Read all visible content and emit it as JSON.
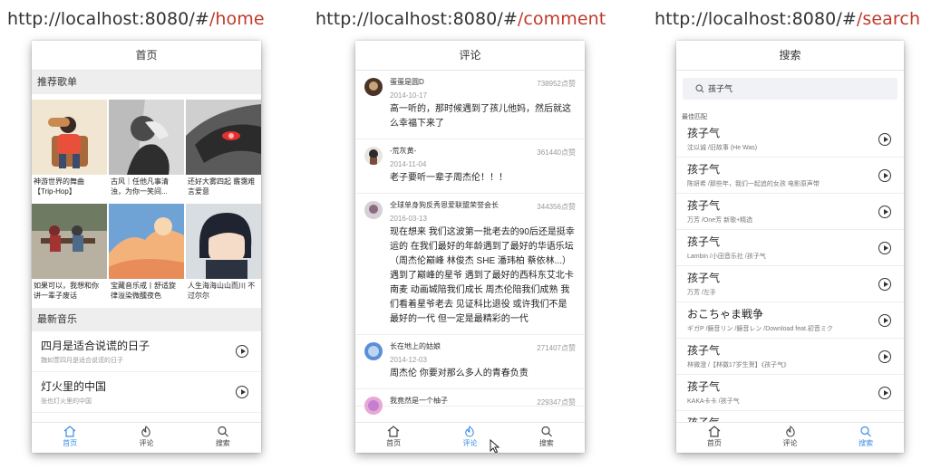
{
  "urls": [
    {
      "base": "http://localhost:8080/#",
      "route": "/home"
    },
    {
      "base": "http://localhost:8080/#",
      "route": "/comment"
    },
    {
      "base": "http://localhost:8080/#",
      "route": "/search"
    }
  ],
  "colors": {
    "accent": "#3a8ee6",
    "route": "#c0392b",
    "section_bg": "#eeeeee"
  },
  "tabs": [
    {
      "label": "首页",
      "icon": "home-icon"
    },
    {
      "label": "评论",
      "icon": "fire-icon"
    },
    {
      "label": "搜索",
      "icon": "search-icon"
    }
  ],
  "home": {
    "title": "首页",
    "recommend_title": "推荐歌单",
    "playlists": [
      {
        "caption": "神游世界的舞曲【Trip-Hop】"
      },
      {
        "caption": "古风｜任他凡事清浊，为你一笑间..."
      },
      {
        "caption": "还好大雾四起 霰霭难言爱意"
      },
      {
        "caption": "如果可以，我想和你讲一辈子废话"
      },
      {
        "caption": "宝藏音乐戒丨舒适旋律溢染微醺夜色"
      },
      {
        "caption": "人生海海山山而川 不过尔尔"
      }
    ],
    "latest_title": "最新音乐",
    "songs": [
      {
        "title": "四月是适合说谎的日子",
        "sub": "魏如萱四月是适合说谎的日子"
      },
      {
        "title": "灯火里的中国",
        "sub": "张也灯火里的中国"
      }
    ]
  },
  "comment": {
    "title": "评论",
    "items": [
      {
        "nick": "蛋蛋是圆D",
        "likes": "738952点赞",
        "date": "2014-10-17",
        "text": "高一听的，那时候遇到了孩儿他妈，然后就这么幸福下来了"
      },
      {
        "nick": "-荒灰黄-",
        "likes": "361440点赞",
        "date": "2014-11-04",
        "text": "老子要听一辈子周杰伦！！！"
      },
      {
        "nick": "全球单身狗反秀恩爱联盟荣誉会长",
        "likes": "344356点赞",
        "date": "2016-03-13",
        "text": "现在想来 我们这波第一批老去的90后还是挺幸运的 在我们最好的年龄遇到了最好的华语乐坛（周杰伦巅峰 林俊杰 SHE 潘玮柏 蔡依林...）遇到了巅峰的星爷 遇到了最好的西科东艾北卡南麦 动画城陪我们成长 周杰伦陪我们成熟 我们看着星爷老去 见证科比退役 或许我们不是最好的一代 但一定是最精彩的一代"
      },
      {
        "nick": "长在地上的姑娘",
        "likes": "271407点赞",
        "date": "2014-12-03",
        "text": "周杰伦 你要对那么多人的青春负责"
      },
      {
        "nick": "我竟然是一个柚子",
        "likes": "229347点赞",
        "date": "",
        "text": ""
      }
    ]
  },
  "search": {
    "title": "搜索",
    "query": "孩子气",
    "best_label": "最佳匹配",
    "results": [
      {
        "title": "孩子气",
        "sub": "沈以诚 /旧故事 (He Was)"
      },
      {
        "title": "孩子气",
        "sub": "陈妍希 /那些年，我们一起追的女孩 电影原声带"
      },
      {
        "title": "孩子气",
        "sub": "万芳 /One芳 新歌+精选"
      },
      {
        "title": "孩子气",
        "sub": "Lambin /小田音乐社 /孩子气"
      },
      {
        "title": "孩子气",
        "sub": "万芳 /左手"
      },
      {
        "title": "おこちゃま戦争",
        "sub": "ギガP /鏡音リン /鏡音レン /Download feat.初音ミク"
      },
      {
        "title": "孩子气",
        "sub": "林微澄 /【林徽17岁生贺】《孩子气》"
      },
      {
        "title": "孩子气",
        "sub": "KAKA卡卡 /孩子气"
      },
      {
        "title": "孩子气",
        "sub": ""
      }
    ]
  }
}
